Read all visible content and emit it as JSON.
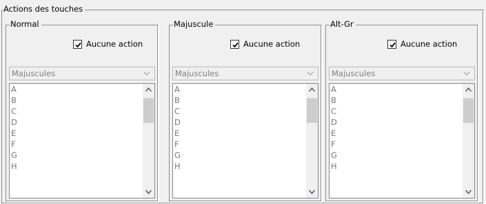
{
  "group": {
    "title": "Actions des touches"
  },
  "panels": [
    {
      "title": "Normal",
      "checkbox": {
        "label": "Aucune action",
        "checked": true
      },
      "select": {
        "value": "Majuscules"
      },
      "list": {
        "items": [
          "A",
          "B",
          "C",
          "D",
          "E",
          "F",
          "G",
          "H"
        ]
      }
    },
    {
      "title": "Majuscule",
      "checkbox": {
        "label": "Aucune action",
        "checked": true
      },
      "select": {
        "value": "Majuscules"
      },
      "list": {
        "items": [
          "A",
          "B",
          "C",
          "D",
          "E",
          "F",
          "G",
          "H"
        ]
      }
    },
    {
      "title": "Alt-Gr",
      "checkbox": {
        "label": "Aucune action",
        "checked": true
      },
      "select": {
        "value": "Majuscules"
      },
      "list": {
        "items": [
          "A",
          "B",
          "C",
          "D",
          "E",
          "F",
          "G",
          "H"
        ]
      }
    }
  ],
  "icons": {
    "dropdown": "chevron-down-icon",
    "scroll_up": "scroll-up-arrow-icon",
    "scroll_down": "scroll-down-arrow-icon",
    "check": "checkmark-icon"
  },
  "colors": {
    "window_bg": "#f0f0f0",
    "border": "#8d8d8d",
    "disabled_text": "#808080",
    "scroll_thumb": "#cdcdcd"
  }
}
